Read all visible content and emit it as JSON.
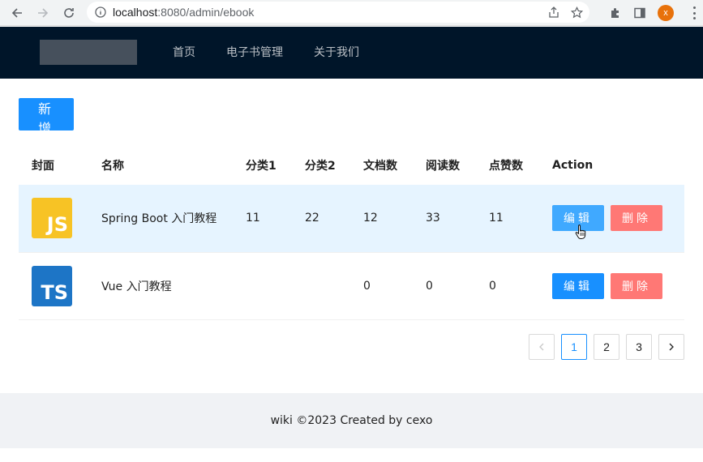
{
  "browser": {
    "url_host": "localhost",
    "url_rest": ":8080/admin/ebook",
    "profile_initial": "x"
  },
  "header": {
    "menu": [
      "首页",
      "电子书管理",
      "关于我们"
    ]
  },
  "toolbar": {
    "add_label": "新增"
  },
  "table": {
    "columns": [
      "封面",
      "名称",
      "分类1",
      "分类2",
      "文档数",
      "阅读数",
      "点赞数",
      "Action"
    ],
    "rows": [
      {
        "cover": "JS",
        "name": "Spring Boot 入门教程",
        "category1": "11",
        "category2": "22",
        "docs": "12",
        "views": "33",
        "likes": "11"
      },
      {
        "cover": "TS",
        "name": "Vue 入门教程",
        "category1": "",
        "category2": "",
        "docs": "0",
        "views": "0",
        "likes": "0"
      }
    ],
    "edit_label": "编辑",
    "delete_label": "删除"
  },
  "pagination": {
    "pages": [
      "1",
      "2",
      "3"
    ],
    "current": "1"
  },
  "footer": {
    "text": "wiki ©2023 Created by cexo"
  },
  "colors": {
    "primary": "#1890ff",
    "danger": "#ff7875",
    "header_bg": "#001529",
    "row_hover": "#e6f4ff"
  }
}
